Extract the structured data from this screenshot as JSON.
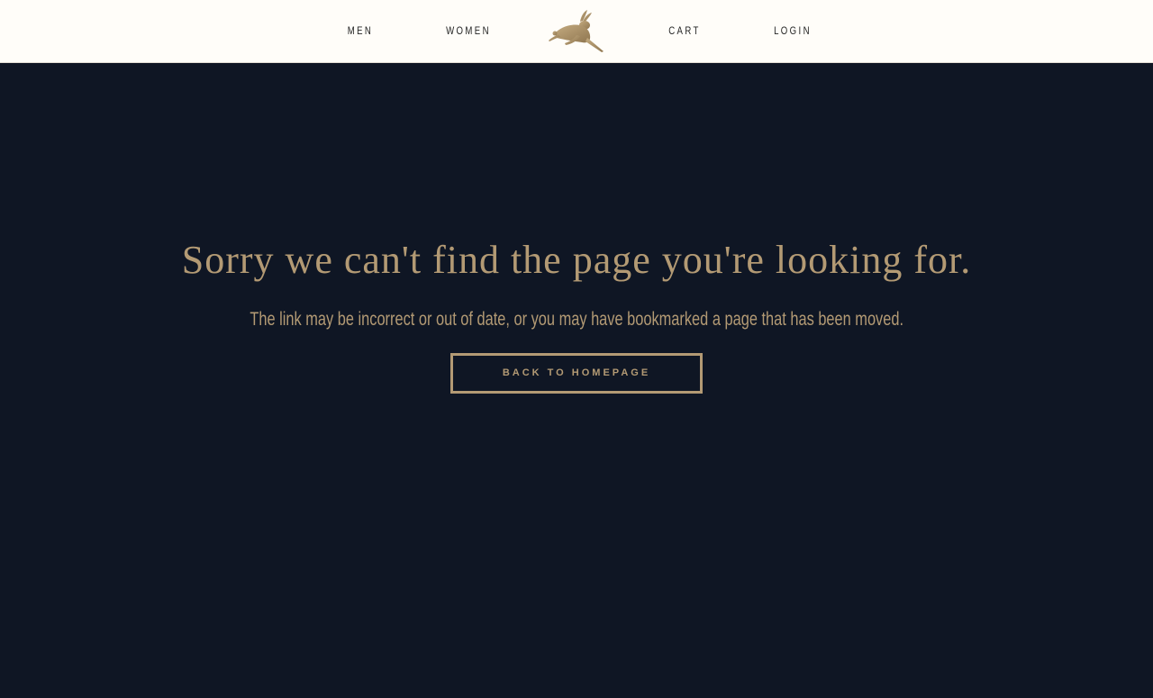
{
  "nav": {
    "men": "MEN",
    "women": "WOMEN",
    "cart": "CART",
    "login": "LOGIN",
    "logo_icon": "hare-icon"
  },
  "error": {
    "headline": "Sorry we can't find the page you're looking for.",
    "message": "The link may be incorrect or out of date, or you may have bookmarked a page that has been moved.",
    "back_label": "BACK TO HOMEPAGE"
  },
  "colors": {
    "background": "#0f1624",
    "header_background": "#fffdf9",
    "accent_gold": "#b39a74",
    "nav_text": "#222222"
  }
}
